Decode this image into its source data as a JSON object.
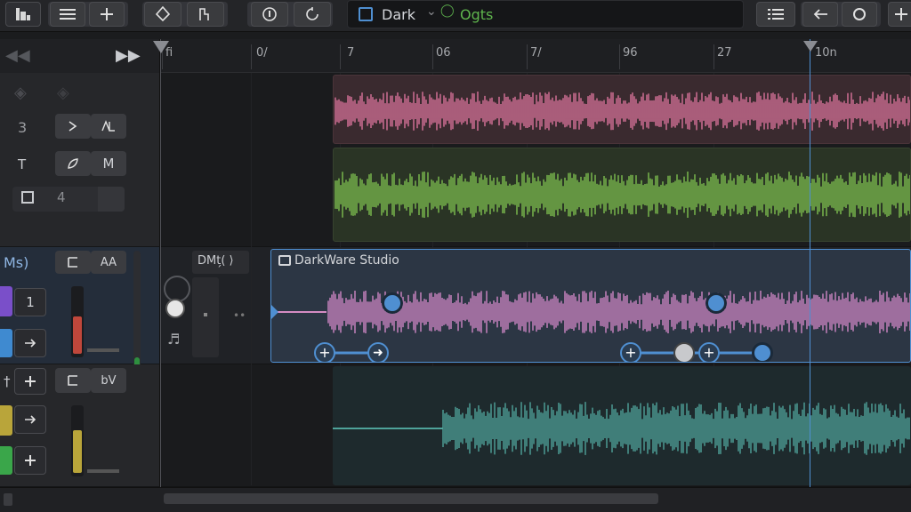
{
  "toolbar": {
    "project_mode": "Dark",
    "project_tag": "Ogts"
  },
  "ruler": {
    "ticks": [
      {
        "label": "fi"
      },
      {
        "label": "0/"
      },
      {
        "label": "7"
      },
      {
        "label": "06"
      },
      {
        "label": "7/"
      },
      {
        "label": "96"
      },
      {
        "label": "27"
      },
      {
        "label": "10n"
      }
    ]
  },
  "tracks": {
    "header1": {
      "number": "3",
      "type_label": "T",
      "btn_m": "M",
      "btn_a": "ᴎᴧ",
      "count": "4"
    },
    "header3": {
      "label": "Ms)",
      "btn_aa": "AA",
      "badge_1": "1"
    },
    "header4": {
      "btn_bv": "bV"
    },
    "plugin": {
      "label": "DMt̗( ⟩"
    },
    "selected_clip": {
      "title": "DarkWare Studio"
    }
  },
  "colors": {
    "pink": "#d9739a",
    "green": "#7dbf4f",
    "violet_pink": "#cf87c6",
    "teal": "#4fa39a",
    "accent": "#4f8fd1"
  },
  "icons": {
    "logo": "logo-icon",
    "menu": "menu-icon",
    "add": "add-icon",
    "pen": "pen-icon",
    "tool": "tool-icon",
    "record": "record-icon",
    "loop": "loop-icon",
    "list": "list-icon",
    "back": "back-icon",
    "circle": "circle-icon",
    "plus": "plus-icon"
  }
}
